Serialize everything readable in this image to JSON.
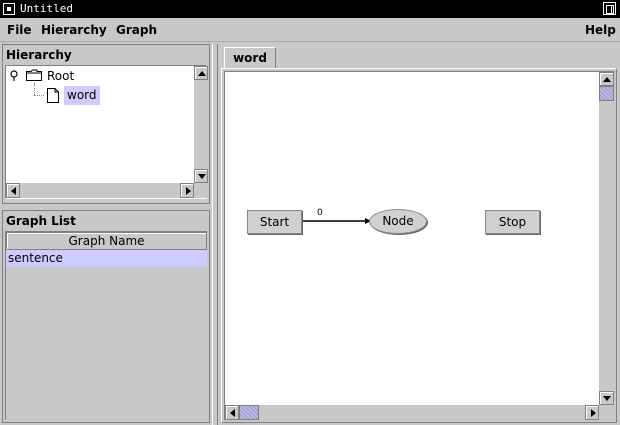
{
  "window": {
    "title": "Untitled"
  },
  "menu": {
    "file": "File",
    "hierarchy": "Hierarchy",
    "graph": "Graph",
    "help": "Help"
  },
  "hierarchy_panel": {
    "title": "Hierarchy",
    "tree": {
      "root_label": "Root",
      "child_label": "word"
    }
  },
  "graph_list_panel": {
    "title": "Graph List",
    "column_header": "Graph Name",
    "rows": [
      "sentence"
    ]
  },
  "editor": {
    "tab_label": "word",
    "nodes": {
      "start": "Start",
      "node": "Node",
      "stop": "Stop"
    },
    "edge_label": "0"
  },
  "colors": {
    "selection": "#ccccff",
    "chrome": "#c8c8c8"
  }
}
